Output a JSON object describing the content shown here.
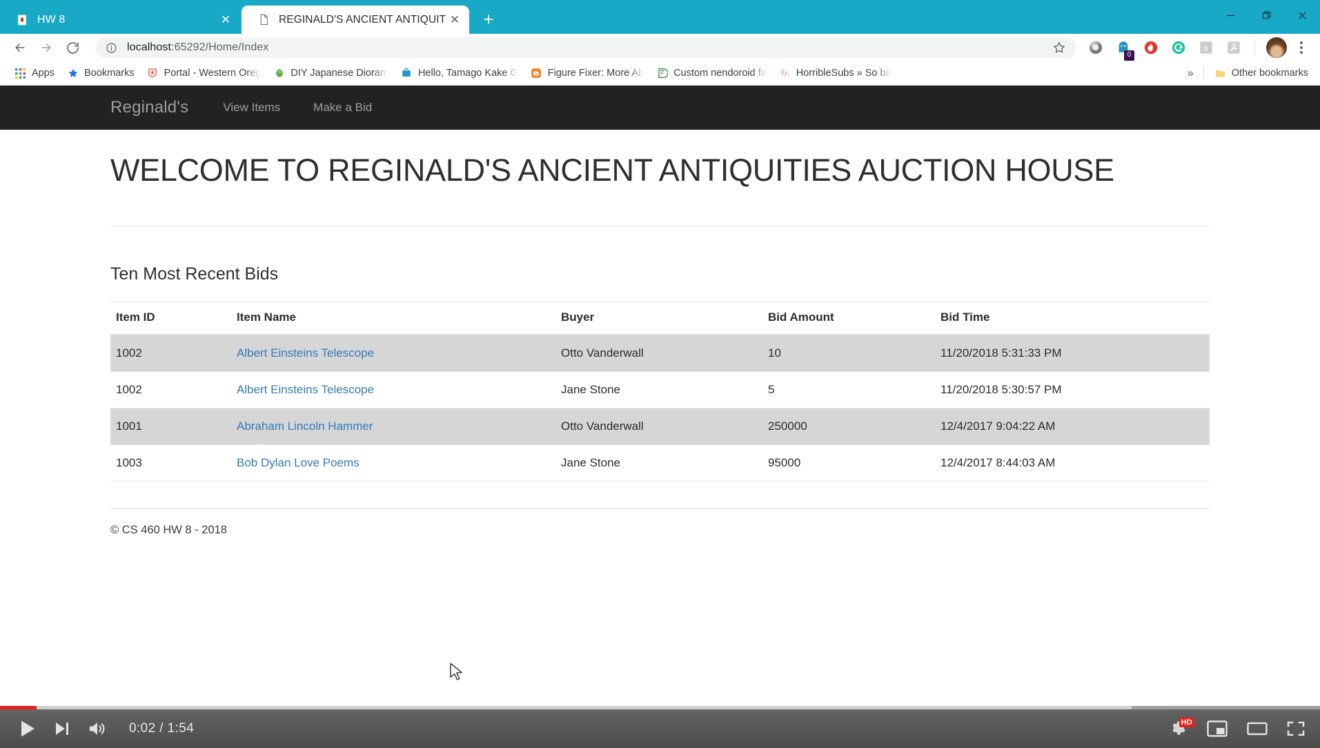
{
  "browser": {
    "window_controls": {
      "minimize": "minimize-icon",
      "maximize": "restore-icon",
      "close": "close-icon"
    },
    "tabs": [
      {
        "title": "HW 8",
        "favicon": "pdf-red-icon",
        "active": false,
        "close_label": "✕"
      },
      {
        "title": "REGINALD'S ANCIENT ANTIQUIT",
        "favicon": "page-document-icon",
        "active": true,
        "close_label": "✕"
      }
    ],
    "new_tab_label": "+",
    "toolbar": {
      "back_label": "back-arrow",
      "forward_label": "forward-arrow",
      "reload_label": "reload-arrow",
      "url_prefix": "localhost",
      "url_suffix": ":65292/Home/Index",
      "url_full": "localhost:65292/Home/Index",
      "info_icon": "info-circle-icon",
      "star_icon": "bookmark-star-icon",
      "extensions": [
        {
          "name": "silver-ring-extension",
          "badge": null
        },
        {
          "name": "ghostery-extension",
          "badge": "0"
        },
        {
          "name": "adblock-hand-extension",
          "badge": null
        },
        {
          "name": "grammarly-extension",
          "badge": null
        },
        {
          "name": "honey-extension",
          "badge": null
        },
        {
          "name": "adobe-acrobat-extension",
          "badge": null
        }
      ],
      "profile_avatar": "user-avatar",
      "menu_label": "chrome-menu-icon"
    },
    "bookmarks": {
      "apps_label": "Apps",
      "items": [
        {
          "label": "Bookmarks",
          "icon": "blue-star-icon"
        },
        {
          "label": "Portal - Western Oreg",
          "icon": "red-shield-icon"
        },
        {
          "label": "DIY Japanese Dioram",
          "icon": "green-dot-icon"
        },
        {
          "label": "Hello, Tamago Kake G",
          "icon": "blue-bag-icon"
        },
        {
          "label": "Figure Fixer: More Ab",
          "icon": "orange-blogger-icon"
        },
        {
          "label": "Custom nendoroid fa",
          "icon": "green-f-icon"
        },
        {
          "label": "HorribleSubs » So ba",
          "icon": "pink-sparkle-icon"
        }
      ],
      "overflow_label": "»",
      "other_bookmarks_label": "Other bookmarks",
      "other_bookmarks_icon": "folder-icon"
    }
  },
  "page": {
    "nav": {
      "brand": "Reginald's",
      "links": [
        "View Items",
        "Make a Bid"
      ]
    },
    "heading": "WELCOME TO REGINALD'S ANCIENT ANTIQUITIES AUCTION HOUSE",
    "section_title": "Ten Most Recent Bids",
    "table": {
      "columns": [
        "Item ID",
        "Item Name",
        "Buyer",
        "Bid Amount",
        "Bid Time"
      ],
      "rows": [
        {
          "item_id": "1002",
          "item_name": "Albert Einsteins Telescope",
          "buyer": "Otto Vanderwall",
          "bid_amount": "10",
          "bid_time": "11/20/2018 5:31:33 PM"
        },
        {
          "item_id": "1002",
          "item_name": "Albert Einsteins Telescope",
          "buyer": "Jane Stone",
          "bid_amount": "5",
          "bid_time": "11/20/2018 5:30:57 PM"
        },
        {
          "item_id": "1001",
          "item_name": "Abraham Lincoln Hammer",
          "buyer": "Otto Vanderwall",
          "bid_amount": "250000",
          "bid_time": "12/4/2017 9:04:22 AM"
        },
        {
          "item_id": "1003",
          "item_name": "Bob Dylan Love Poems",
          "buyer": "Jane Stone",
          "bid_amount": "95000",
          "bid_time": "12/4/2017 8:44:03 AM"
        }
      ]
    },
    "footer": "© CS 460 HW 8 - 2018"
  },
  "player": {
    "play_icon": "play-icon",
    "next_icon": "next-track-icon",
    "volume_icon": "volume-on-icon",
    "time_current": "0:02",
    "time_total": "1:54",
    "time_display": "0:02 / 1:54",
    "settings_icon": "settings-gear-icon",
    "hd_badge": "HD",
    "miniplayer_icon": "miniplayer-icon",
    "theater_icon": "theater-mode-icon",
    "fullscreen_icon": "fullscreen-icon",
    "progress_color": "#e62117"
  }
}
